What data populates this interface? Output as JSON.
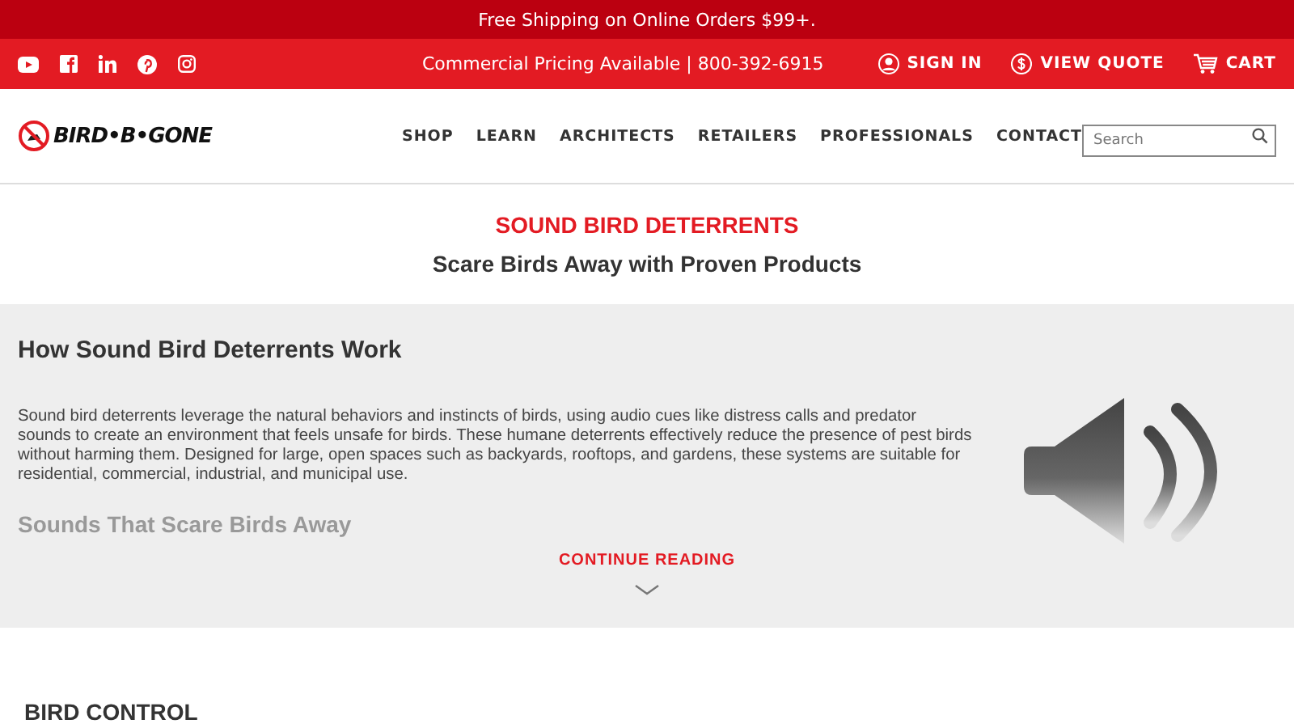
{
  "promo_bar": {
    "text": "Free Shipping on Online Orders $99+."
  },
  "utility_bar": {
    "social": [
      {
        "kind": "youtube"
      },
      {
        "kind": "facebook"
      },
      {
        "kind": "linkedin"
      },
      {
        "kind": "pinterest"
      },
      {
        "kind": "instagram"
      }
    ],
    "pricing": "Commercial Pricing Available | 800-392-6915",
    "links": [
      {
        "kind": "user",
        "label": "SIGN IN"
      },
      {
        "kind": "quote",
        "label": "VIEW QUOTE"
      },
      {
        "kind": "cart",
        "label": "CART"
      }
    ]
  },
  "header": {
    "logo": "BIRD•B•GONE",
    "nav": [
      "SHOP",
      "LEARN",
      "ARCHITECTS",
      "RETAILERS",
      "PROFESSIONALS",
      "CONTACT"
    ],
    "search": {
      "placeholder": "Search"
    }
  },
  "hero": {
    "title": "SOUND BIRD DETERRENTS",
    "subtitle": "Scare Birds Away with Proven Products"
  },
  "article": {
    "heading": "How Sound Bird Deterrents Work",
    "body": "Sound bird deterrents leverage the natural behaviors and instincts of birds, using audio cues like distress calls and predator sounds to create an environment that feels unsafe for birds. These humane deterrents effectively reduce the presence of pest birds without harming them. Designed for large, open spaces such as backyards, rooftops, and gardens, these systems are suitable for residential, commercial, industrial, and municipal use.",
    "faded_heading": "Sounds That Scare Birds Away",
    "more": "CONTINUE READING"
  },
  "section": {
    "heading": "BIRD CONTROL"
  }
}
